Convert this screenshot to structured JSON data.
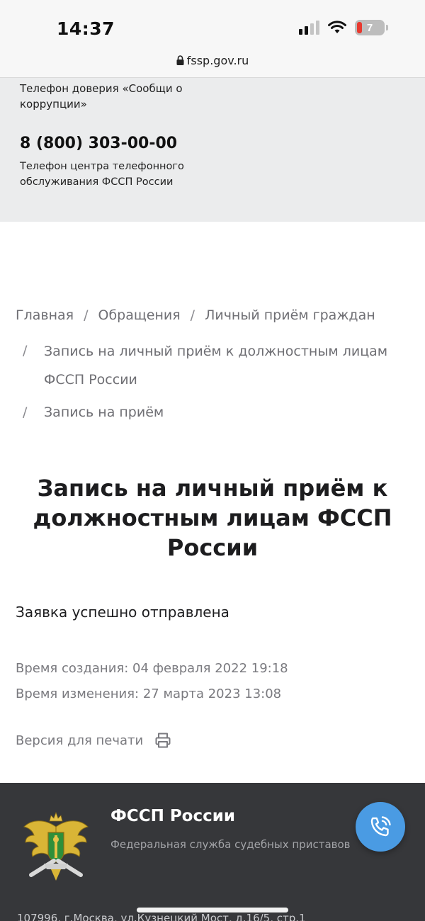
{
  "status_bar": {
    "time": "14:37",
    "battery": "7"
  },
  "browser": {
    "url": "fssp.gov.ru"
  },
  "contact": {
    "hotline_label": "Телефон доверия «Сообщи о коррупции»",
    "phone": "8 (800) 303-00-00",
    "phone_label": "Телефон центра телефонного обслуживания ФССП России"
  },
  "breadcrumbs": {
    "items": [
      "Главная",
      "Обращения",
      "Личный приём граждан",
      "Запись на личный приём к должностным лицам ФССП России",
      "Запись на приём"
    ],
    "separator": "/"
  },
  "page": {
    "title": "Запись на личный приём к должностным лицам ФССП России",
    "status": "Заявка успешно отправлена",
    "created": "Время создания: 04 февраля 2022 19:18",
    "modified": "Время изменения: 27 марта 2023 13:08",
    "print_label": "Версия для печати"
  },
  "footer": {
    "title": "ФССП России",
    "subtitle": "Федеральная служба судебных приставов",
    "address": "107996, г.Москва, ул.Кузнецкий Мост, д.16/5, стр.1"
  },
  "colors": {
    "accent": "#4a9be3",
    "footer_bg": "#36373a",
    "contact_bg": "#ebeced"
  }
}
